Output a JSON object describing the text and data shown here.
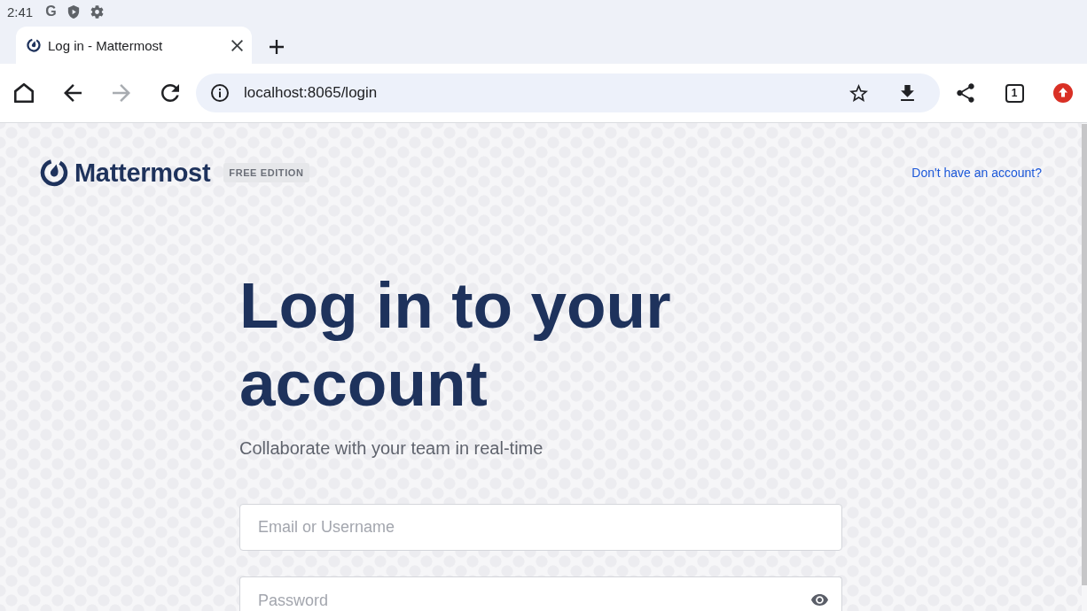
{
  "status_bar": {
    "time": "2:41",
    "icons": [
      {
        "kind": "letter",
        "text": "G"
      },
      {
        "kind": "shield"
      },
      {
        "kind": "gear"
      }
    ]
  },
  "browser": {
    "tabs": [
      {
        "title": "Log in - Mattermost",
        "selected": true
      }
    ],
    "nav_buttons": [
      {
        "kind": "home",
        "disabled": false
      },
      {
        "kind": "back",
        "disabled": false
      },
      {
        "kind": "forward",
        "disabled": true
      },
      {
        "kind": "reload",
        "disabled": false
      }
    ],
    "address": "localhost:8065/login",
    "tab_count": "1"
  },
  "page": {
    "brand": "Mattermost",
    "edition_badge": "FREE EDITION",
    "signup_link": "Don't have an account?",
    "heading": "Log in to your account",
    "subtitle": "Collaborate with your team in real-time",
    "fields": [
      {
        "kind": "text",
        "placeholder": "Email or Username"
      },
      {
        "kind": "password",
        "placeholder": "Password"
      }
    ]
  }
}
